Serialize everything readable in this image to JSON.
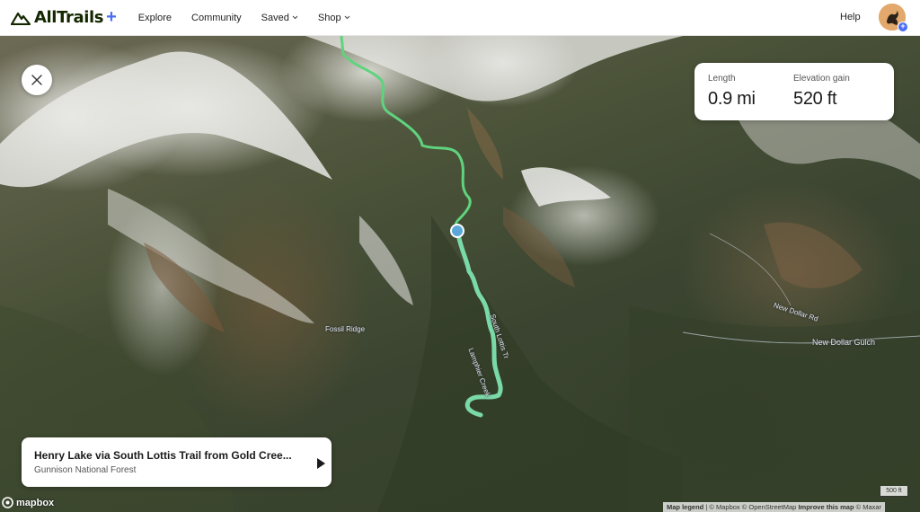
{
  "nav": {
    "brand": "AllTrails",
    "brand_plus": "+",
    "items": [
      {
        "label": "Explore",
        "has_dropdown": false
      },
      {
        "label": "Community",
        "has_dropdown": false
      },
      {
        "label": "Saved",
        "has_dropdown": true
      },
      {
        "label": "Shop",
        "has_dropdown": true
      }
    ],
    "help": "Help"
  },
  "stats": {
    "length_label": "Length",
    "length_value": "0.9 mi",
    "elevation_label": "Elevation gain",
    "elevation_value": "520 ft"
  },
  "trail": {
    "name": "Henry Lake via South Lottis Trail from Gold Cree...",
    "area": "Gunnison National Forest"
  },
  "map_labels": {
    "ridge": "Fossil Ridge",
    "gulch": "New Dollar Gulch",
    "road": "New Dollar Rd",
    "trail_a": "South Lottis Tr",
    "trail_b": "Lamphier Creek"
  },
  "mapbox": "mapbox",
  "scale": "500 ft",
  "attribution": {
    "legend": "Map legend",
    "mapbox": "© Mapbox",
    "osm": "© OpenStreetMap",
    "improve": "Improve this map",
    "maxar": "© Maxar"
  },
  "colors": {
    "trail_line": "#6fdc8c",
    "trail_line_highlight": "#8fe3bd",
    "marker": "#5ba7d9",
    "brand_plus": "#4a6cf7"
  },
  "icons": {
    "close": "close-icon",
    "play": "play-icon",
    "chevron": "chevron-down-icon"
  }
}
